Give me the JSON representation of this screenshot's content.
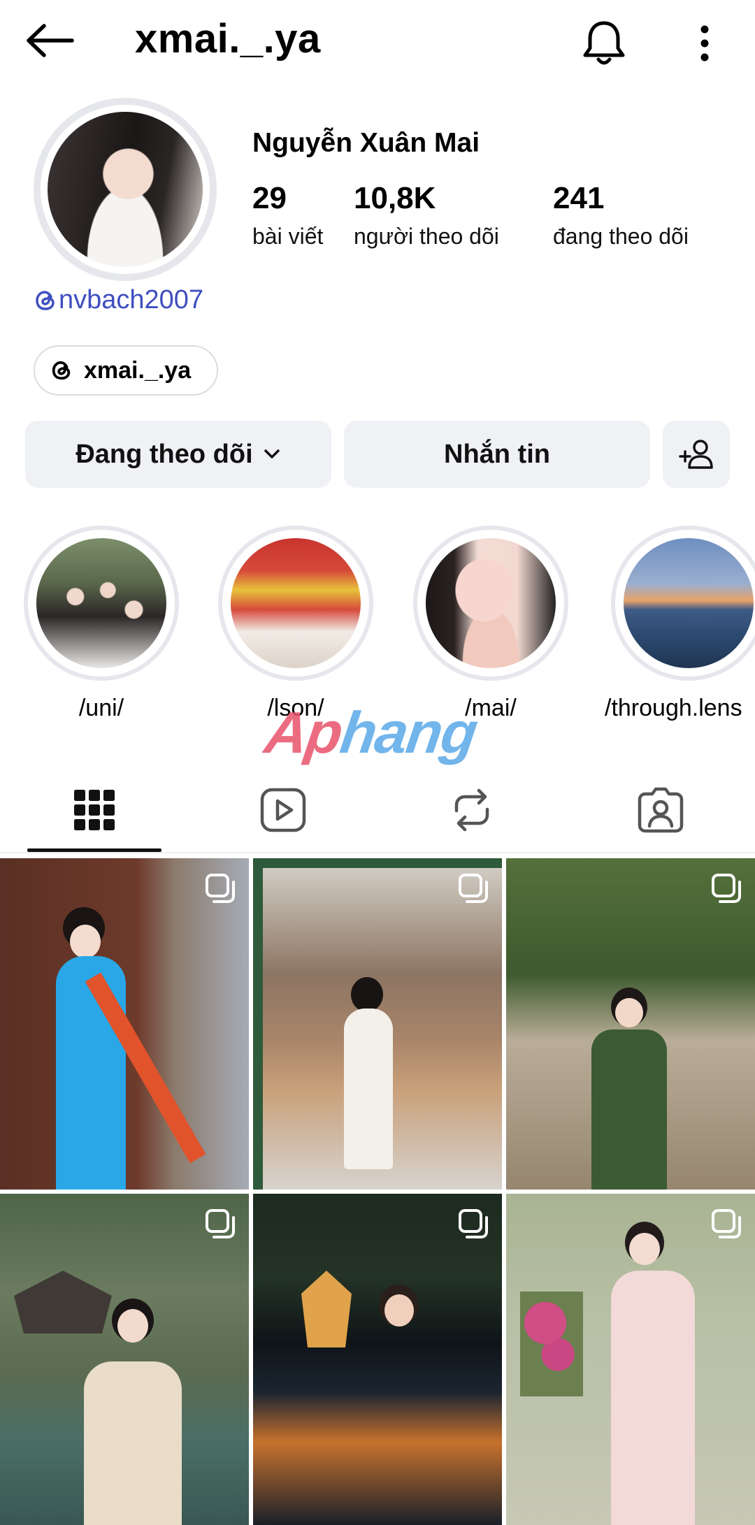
{
  "header": {
    "username": "xmai._.ya"
  },
  "profile": {
    "display_name": "Nguyễn Xuân Mai",
    "threads_handle": "nvbach2007",
    "threads_badge": "xmai._.ya",
    "stats": [
      {
        "value": "29",
        "label": "bài viết"
      },
      {
        "value": "10,8K",
        "label": "người theo dõi"
      },
      {
        "value": "241",
        "label": "đang theo dõi"
      }
    ]
  },
  "actions": {
    "following_label": "Đang theo dõi",
    "message_label": "Nhắn tin"
  },
  "highlights": [
    {
      "label": "/uni/"
    },
    {
      "label": "/lson/"
    },
    {
      "label": "/mai/"
    },
    {
      "label": "/through.lens"
    }
  ],
  "watermark": {
    "part1": "Ap",
    "part2": "hang"
  },
  "tabs": [
    {
      "icon": "grid-icon"
    },
    {
      "icon": "reels-icon"
    },
    {
      "icon": "reposts-icon"
    },
    {
      "icon": "tagged-icon"
    }
  ],
  "colors": {
    "link": "#3f4fbf",
    "button_bg": "#eff1f5",
    "ring": "#e6e7ec"
  }
}
